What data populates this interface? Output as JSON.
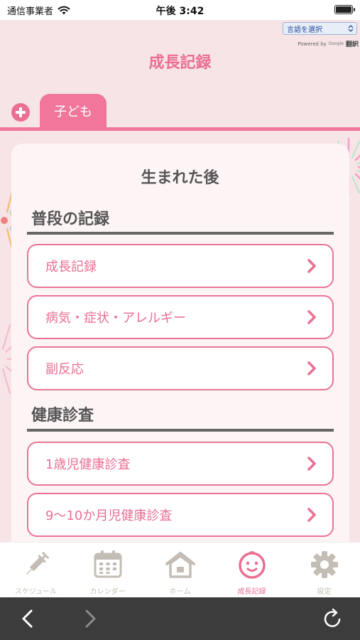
{
  "status_bar": {
    "carrier": "通信事業者",
    "time": "午後 3:42"
  },
  "translate": {
    "select_label": "言語を選択",
    "powered_by": "Powered by",
    "google": "Google",
    "translate_word": "翻訳"
  },
  "header": {
    "title": "成長記録"
  },
  "tabs": {
    "child_label": "子ども"
  },
  "card": {
    "title": "生まれた後",
    "sections": [
      {
        "title": "普段の記録",
        "items": [
          {
            "label": "成長記録"
          },
          {
            "label": "病気・症状・アレルギー"
          },
          {
            "label": "副反応"
          }
        ]
      },
      {
        "title": "健康診査",
        "items": [
          {
            "label": "1歳児健康診査"
          },
          {
            "label": "9〜10か月児健康診査"
          }
        ]
      }
    ]
  },
  "bottom_nav": {
    "items": [
      {
        "label": "スケジュール",
        "icon": "syringe-icon"
      },
      {
        "label": "カレンダー",
        "icon": "calendar-icon"
      },
      {
        "label": "ホーム",
        "icon": "house-icon"
      },
      {
        "label": "成長記録",
        "icon": "baby-face-icon",
        "active": true
      },
      {
        "label": "設定",
        "icon": "gear-icon"
      }
    ]
  },
  "colors": {
    "accent": "#ea6f93",
    "background": "#f7e4e6",
    "card": "#fdf4f5",
    "inactive_icon": "#c4bdb5",
    "browser_bar": "#3c3c3c"
  }
}
